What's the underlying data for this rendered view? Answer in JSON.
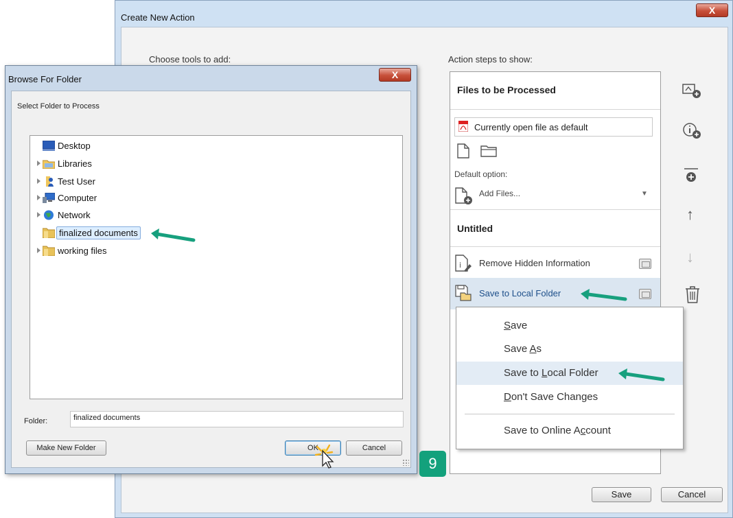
{
  "create_action": {
    "title": "Create New Action",
    "close_label": "X",
    "choose_tools_label": "Choose tools to add:",
    "action_steps_label": "Action steps to show:",
    "files_header": "Files to be Processed",
    "file_source": "Currently open file as default",
    "default_option_label": "Default option:",
    "add_files_label": "Add Files...",
    "group_header": "Untitled",
    "steps": [
      {
        "label": "Remove Hidden Information"
      },
      {
        "label": "Save to Local Folder"
      }
    ],
    "save_button": "Save",
    "cancel_button": "Cancel"
  },
  "browse_folder": {
    "title": "Browse For Folder",
    "close_label": "X",
    "prompt": "Select Folder to Process",
    "tree": [
      {
        "label": "Desktop",
        "icon": "desktop-icon"
      },
      {
        "label": "Libraries",
        "icon": "libraries-icon"
      },
      {
        "label": "Test User",
        "icon": "user-icon"
      },
      {
        "label": "Computer",
        "icon": "computer-icon"
      },
      {
        "label": "Network",
        "icon": "network-icon"
      },
      {
        "label": "finalized documents",
        "icon": "folder-icon",
        "selected": true
      },
      {
        "label": "working files",
        "icon": "folder-icon"
      }
    ],
    "folder_label": "Folder:",
    "folder_value": "finalized documents",
    "make_new_folder": "Make New Folder",
    "ok": "OK",
    "cancel": "Cancel"
  },
  "context_menu": {
    "items": [
      {
        "pre": "",
        "ul": "S",
        "post": "ave"
      },
      {
        "pre": "Save ",
        "ul": "A",
        "post": "s"
      },
      {
        "pre": "Save to ",
        "ul": "L",
        "post": "ocal Folder"
      },
      {
        "pre": "",
        "ul": "D",
        "post": "on't Save Changes"
      },
      {
        "pre": "Save to Online A",
        "ul": "c",
        "post": "count"
      }
    ]
  },
  "step_badge": "9",
  "colors": {
    "annotation_arrow": "#17a07e",
    "selection": "#dbe6f1"
  }
}
